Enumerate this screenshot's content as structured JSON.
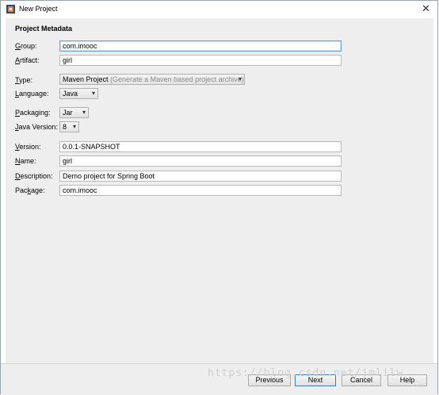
{
  "window": {
    "title": "New Project",
    "close_glyph": "✕"
  },
  "form": {
    "section_title": "Project Metadata",
    "group": {
      "label": "Group:",
      "mnemonic": "G",
      "rest": "roup:",
      "value": "com.imooc"
    },
    "artifact": {
      "label": "Artifact:",
      "mnemonic": "A",
      "rest": "rtifact:",
      "value": "girl"
    },
    "type": {
      "label": "Type:",
      "mnemonic": "T",
      "rest": "ype:",
      "value": "Maven Project",
      "hint": "(Generate a Maven based project archive)"
    },
    "language": {
      "label": "Language:",
      "mnemonic": "L",
      "rest": "anguage:",
      "value": "Java"
    },
    "packaging": {
      "label": "Packaging:",
      "mnemonic": "P",
      "rest": "ackaging:",
      "value": "Jar"
    },
    "java_version": {
      "label": "Java Version:",
      "mnemonic": "J",
      "rest": "ava Version:",
      "value": "8"
    },
    "version": {
      "label": "Version:",
      "mnemonic": "V",
      "rest": "ersion:",
      "value": "0.0.1-SNAPSHOT"
    },
    "name": {
      "label": "Name:",
      "mnemonic": "N",
      "rest": "ame:",
      "value": "girl"
    },
    "description": {
      "label": "Description:",
      "mnemonic": "D",
      "rest": "escription:",
      "value": "Demo project for Spring Boot"
    },
    "package": {
      "label": "Package:",
      "pre": "Pac",
      "mnemonic": "k",
      "rest": "age:",
      "value": "com.imooc"
    }
  },
  "buttons": {
    "previous": "Previous",
    "next": "Next",
    "cancel": "Cancel",
    "help": "Help"
  },
  "watermark": "https://blog.csdn.net/jmlilw",
  "icons": {
    "app": "netbeans-icon",
    "dropdown": "chevron-down-icon"
  }
}
